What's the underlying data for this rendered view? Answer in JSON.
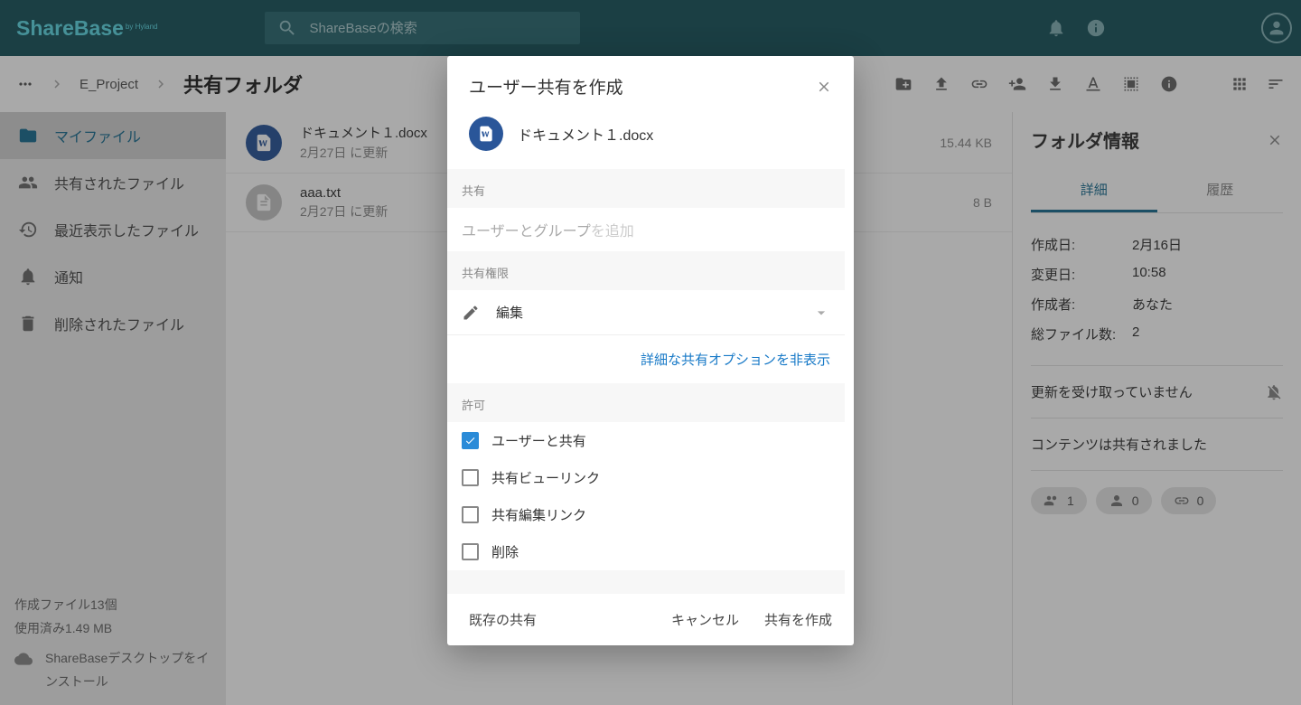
{
  "header": {
    "logo_main": "ShareBase",
    "logo_sub": "by Hyland",
    "search_placeholder": "ShareBaseの検索"
  },
  "breadcrumb": {
    "parent": "E_Project",
    "current": "共有フォルダ"
  },
  "sidebar": {
    "items": [
      {
        "label": "マイファイル"
      },
      {
        "label": "共有されたファイル"
      },
      {
        "label": "最近表示したファイル"
      },
      {
        "label": "通知"
      },
      {
        "label": "削除されたファイル"
      }
    ],
    "stats_files": "作成ファイル13個",
    "stats_storage": "使用済み1.49 MB",
    "install_label": "ShareBaseデスクトップをインストール"
  },
  "files": [
    {
      "name": "ドキュメント１.docx",
      "updated": "2月27日 に更新",
      "size": "15.44 KB",
      "type": "word"
    },
    {
      "name": "aaa.txt",
      "updated": "2月27日 に更新",
      "size": "8 B",
      "type": "text"
    }
  ],
  "info_panel": {
    "title": "フォルダ情報",
    "tab_details": "詳細",
    "tab_history": "履歴",
    "rows": [
      {
        "k": "作成日:",
        "v": "2月16日"
      },
      {
        "k": "変更日:",
        "v": "10:58"
      },
      {
        "k": "作成者:",
        "v": "あなた"
      },
      {
        "k": "総ファイル数:",
        "v": "2"
      }
    ],
    "update_text": "更新を受け取っていません",
    "shared_text": "コンテンツは共有されました",
    "chips": [
      {
        "count": "1"
      },
      {
        "count": "0"
      },
      {
        "count": "0"
      }
    ]
  },
  "modal": {
    "title": "ユーザー共有を作成",
    "doc_name": "ドキュメント１.docx",
    "section_share": "共有",
    "user_placeholder_strong": "ユーザーとグループ",
    "user_placeholder_rest": "を追加",
    "section_perm": "共有権限",
    "perm_value": "編集",
    "advanced_link": "詳細な共有オプションを非表示",
    "section_allow": "許可",
    "checks": [
      {
        "label": "ユーザーと共有",
        "checked": true
      },
      {
        "label": "共有ビューリンク",
        "checked": false
      },
      {
        "label": "共有編集リンク",
        "checked": false
      },
      {
        "label": "削除",
        "checked": false
      }
    ],
    "footer_existing": "既存の共有",
    "footer_cancel": "キャンセル",
    "footer_create": "共有を作成"
  }
}
